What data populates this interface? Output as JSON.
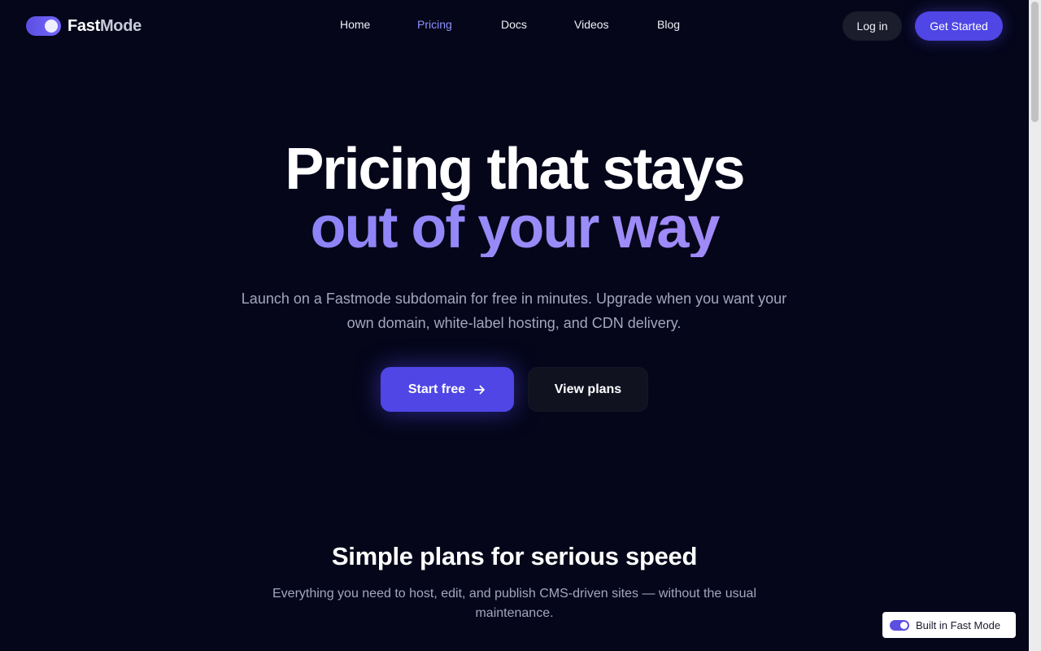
{
  "brand": {
    "name_part1": "Fast",
    "name_part2": "Mode",
    "accent_color": "#4f46e5",
    "icon": "toggle-switch-icon"
  },
  "nav": {
    "items": [
      {
        "label": "Home",
        "active": false
      },
      {
        "label": "Pricing",
        "active": true
      },
      {
        "label": "Docs",
        "active": false
      },
      {
        "label": "Videos",
        "active": false
      },
      {
        "label": "Blog",
        "active": false
      }
    ],
    "active_color": "#8d93ff"
  },
  "header": {
    "login_label": "Log in",
    "cta_label": "Get Started"
  },
  "hero": {
    "title_line1": "Pricing that stays",
    "title_line2": "out of your way",
    "subtitle": "Launch on a Fastmode subdomain for free in minutes. Upgrade when you want your own domain, white-label hosting, and CDN delivery.",
    "primary_button": {
      "label": "Start free",
      "icon": "arrow-right-icon"
    },
    "secondary_button": {
      "label": "View plans"
    }
  },
  "plans": {
    "title": "Simple plans for serious speed",
    "subtitle": "Everything you need to host, edit, and publish CMS-driven sites — without the usual maintenance."
  },
  "badge": {
    "label": "Built in Fast Mode",
    "icon": "toggle-switch-icon"
  },
  "colors": {
    "background": "#05061a",
    "muted_text": "#a3a7bd"
  }
}
